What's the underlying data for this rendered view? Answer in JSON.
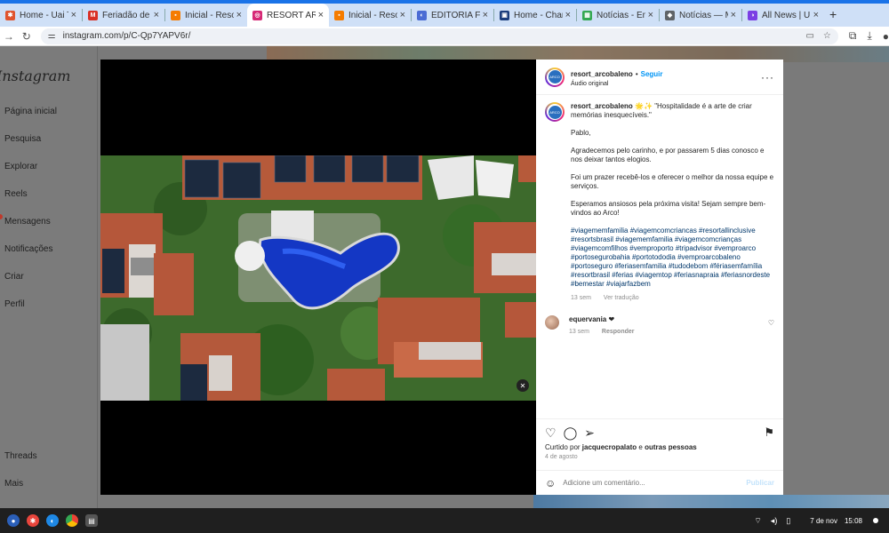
{
  "browser": {
    "tabs": [
      {
        "label": "Home - Uai T",
        "fav_color": "#e0542e",
        "fav": "✱"
      },
      {
        "label": "Feriadão de s",
        "fav_color": "#d93025",
        "fav": "M"
      },
      {
        "label": "Inicial - Resor",
        "fav_color": "#f57c00",
        "fav": "▪"
      },
      {
        "label": "RESORT ARCO",
        "fav_color": "#d62976",
        "fav": "◎",
        "active": true
      },
      {
        "label": "Inicial - Resor",
        "fav_color": "#f57c00",
        "fav": "▪"
      },
      {
        "label": "EDITORIA FE",
        "fav_color": "#4a6cd4",
        "fav": "◐"
      },
      {
        "label": "Home - Chan",
        "fav_color": "#1a3d7c",
        "fav": "▣"
      },
      {
        "label": "Notícias - Em",
        "fav_color": "#34a853",
        "fav": "▦"
      },
      {
        "label": "Notícias — M",
        "fav_color": "#5f6368",
        "fav": "◆"
      },
      {
        "label": "All News | UN",
        "fav_color": "#7b3fe4",
        "fav": "◑"
      }
    ],
    "new_tab": "+",
    "url": "instagram.com/p/C-Qp7YAPV6r/"
  },
  "sidebar": {
    "logo": "Instagram",
    "items": [
      "Página inicial",
      "Pesquisa",
      "Explorar",
      "Reels",
      "Mensagens",
      "Notificações",
      "Criar",
      "Perfil"
    ],
    "bottom_items": [
      "Threads",
      "Mais"
    ]
  },
  "post": {
    "username": "resort_arcobaleno",
    "follow": "Seguir",
    "audio": "Áudio original",
    "avatar_text": "ARCO",
    "caption_user": "resort_arcobaleno",
    "caption_lines": [
      "🌟✨ \"Hospitalidade é a arte de criar memórias inesquecíveis.\"",
      "Pablo,",
      "Agradecemos pelo carinho, e por passarem 5 dias conosco e nos deixar tantos elogios.",
      "Foi um prazer recebê-los e oferecer o melhor da nossa equipe e serviços.",
      "Esperamos ansiosos pela próxima visita! Sejam sempre bem-vindos ao Arco!"
    ],
    "hashtags": "#viagememfamilia #viagemcomcriancas #resortallinclusive #resortsbrasil #viagememfamilia #viagemcomcrianças #viagemcomfilhos #vemproporto #tripadvisor #vemproarco #portosegurobahia #portotododia #vemproarcobaleno #portoseguro   #feriasemfamilia #tudodebom #fériasemfamília #resortbrasil #ferias #viagemtop #feriasnapraia #feriasnordeste #bemestar #viajarfazbem",
    "caption_time": "13 sem",
    "translate": "Ver tradução",
    "comment": {
      "user": "equervania",
      "text": "❤",
      "time": "13 sem",
      "reply": "Responder"
    },
    "liked_prefix": "Curtido por ",
    "liked_user": "jacquecropalato",
    "liked_mid": " e ",
    "liked_others": "outras pessoas",
    "date": "4 de agosto",
    "comment_placeholder": "Adicione um comentário...",
    "publish": "Publicar"
  },
  "taskbar": {
    "date": "7 de nov",
    "time": "15:08"
  }
}
